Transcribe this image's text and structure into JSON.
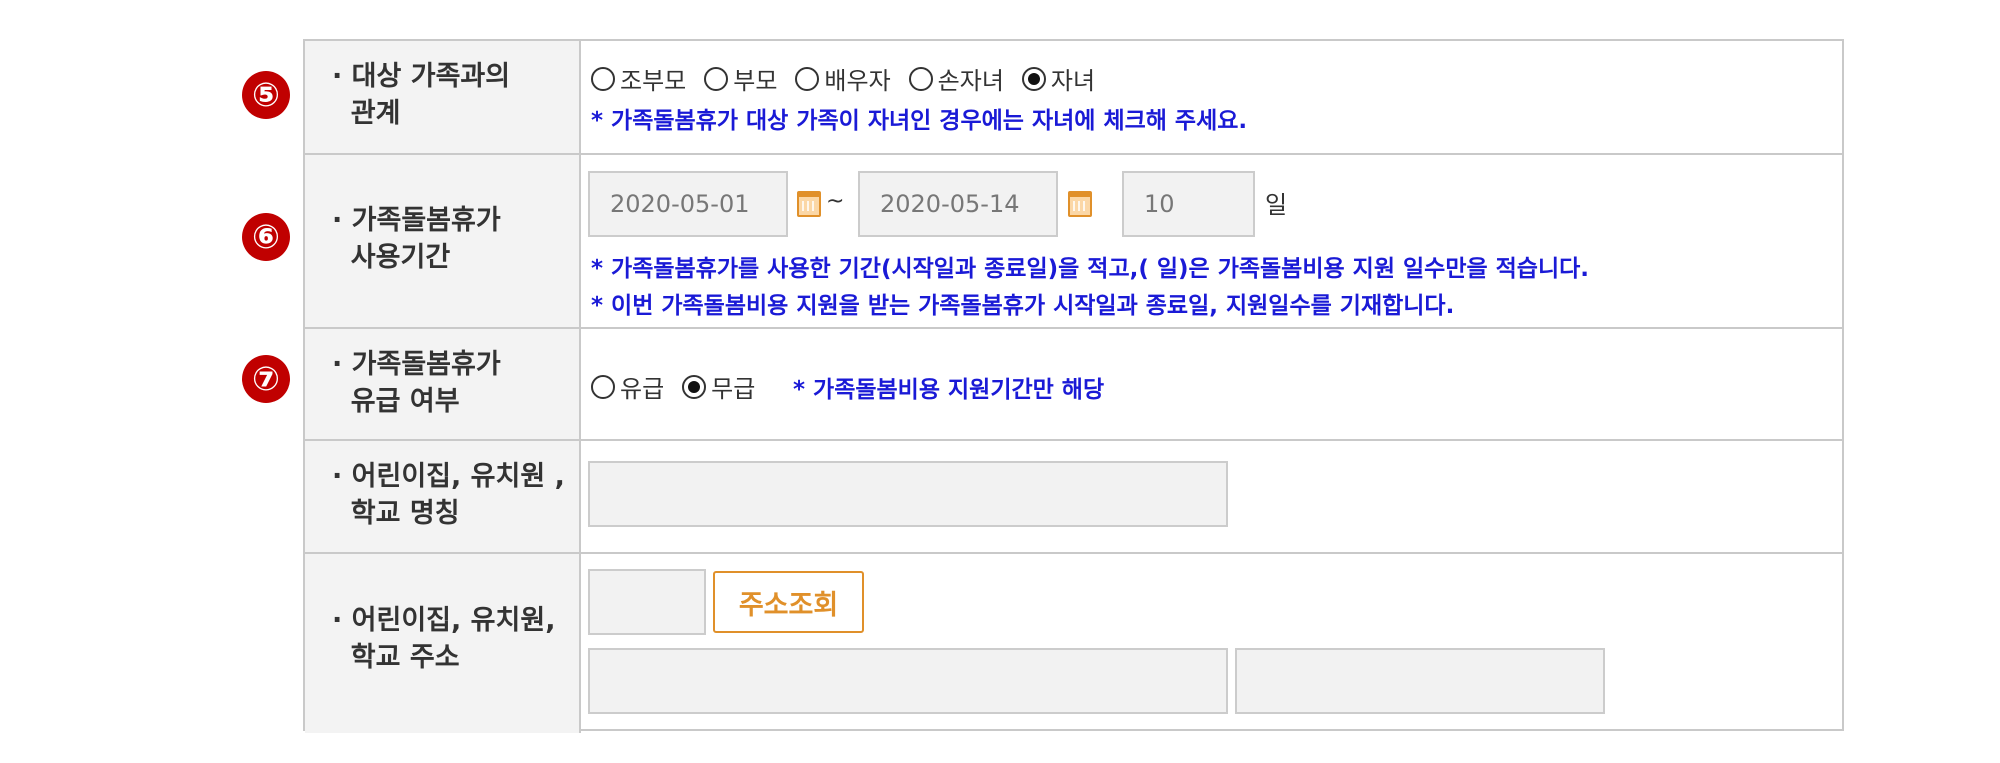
{
  "rows": {
    "relation": {
      "marker": "⑤",
      "label": "· 대상 가족과의\n  관계",
      "options": [
        {
          "label": "조부모",
          "checked": false
        },
        {
          "label": "부모",
          "checked": false
        },
        {
          "label": "배우자",
          "checked": false
        },
        {
          "label": "손자녀",
          "checked": false
        },
        {
          "label": "자녀",
          "checked": true
        }
      ],
      "note": "* 가족돌봄휴가 대상 가족이 자녀인 경우에는 자녀에 체크해 주세요."
    },
    "period": {
      "marker": "⑥",
      "label": "· 가족돌봄휴가\n  사용기간",
      "start_date": "2020-05-01",
      "separator": "~",
      "end_date": "2020-05-14",
      "days": "10",
      "days_unit": "일",
      "notes": [
        "* 가족돌봄휴가를 사용한 기간(시작일과 종료일)을 적고,( 일)은 가족돌봄비용 지원 일수만을 적습니다.",
        "* 이번 가족돌봄비용 지원을 받는 가족돌봄휴가 시작일과 종료일, 지원일수를 기재합니다."
      ]
    },
    "paid": {
      "marker": "⑦",
      "label": "· 가족돌봄휴가\n  유급 여부",
      "options": [
        {
          "label": "유급",
          "checked": false
        },
        {
          "label": "무급",
          "checked": true
        }
      ],
      "note": "* 가족돌봄비용 지원기간만 해당"
    },
    "school_name": {
      "label": "· 어린이집, 유치원 ,\n  학교 명칭",
      "value": ""
    },
    "school_address": {
      "label": "· 어린이집, 유치원,\n  학교 주소",
      "zipcode": "",
      "search_button": "주소조회",
      "address1": "",
      "address2": ""
    }
  },
  "colors": {
    "marker": "#c00000",
    "note": "#1a1ad6",
    "button_accent": "#e0902a",
    "header_bg": "#f3f3f3"
  },
  "icons": {
    "calendar": "calendar-icon"
  }
}
